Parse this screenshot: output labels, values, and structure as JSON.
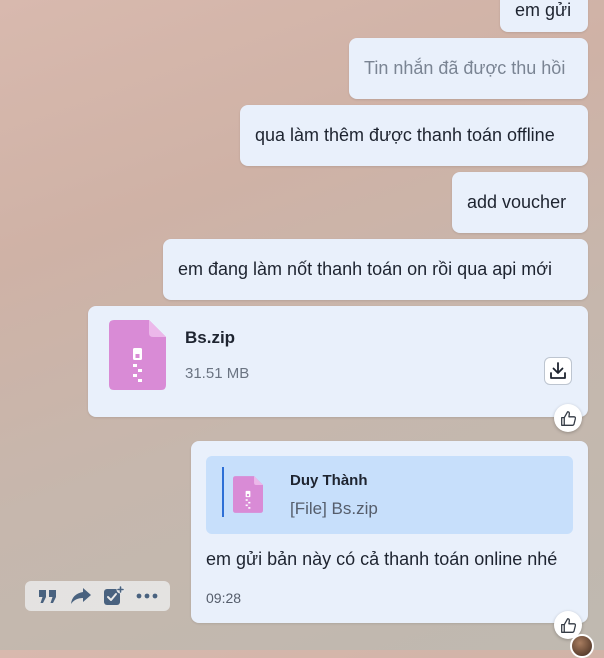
{
  "messages": [
    {
      "text": "em gửi"
    },
    {
      "text": "Tin nhắn đã được thu hồi"
    },
    {
      "text": "qua làm thêm được thanh toán offline"
    },
    {
      "text": "add voucher"
    },
    {
      "text": "em đang làm nốt thanh toán on rồi qua api mới"
    }
  ],
  "file_message": {
    "name": "Bs.zip",
    "size": "31.51 MB",
    "icon": "zip-file-icon",
    "download_icon": "download-icon",
    "reaction_icon": "thumbs-up-icon"
  },
  "reply_message": {
    "quote": {
      "sender": "Duy Thành",
      "content": "[File] Bs.zip",
      "icon": "zip-file-icon"
    },
    "text": "em gửi bản này có cả thanh toán online nhé",
    "time": "09:28",
    "reaction_icon": "thumbs-up-icon"
  },
  "toolbar": {
    "icons": [
      "quote-icon",
      "forward-icon",
      "add-task-icon",
      "more-icon"
    ]
  },
  "colors": {
    "bubble": "#e9f0fb",
    "quote_box": "#c7dffb",
    "quote_bar": "#2d6fd6",
    "zip_icon": "#d98bd6"
  }
}
